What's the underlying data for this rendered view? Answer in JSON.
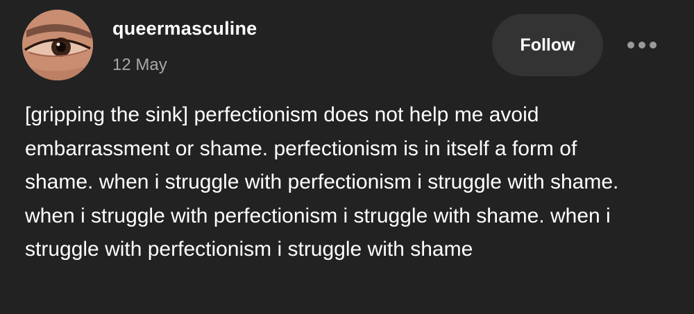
{
  "post": {
    "avatar_icon": "avatar-eye-closeup",
    "username": "queermasculine",
    "date": "12 May",
    "follow_label": "Follow",
    "more_icon": "more-horizontal-icon",
    "body": "[gripping the sink] perfectionism does not help me avoid embarrassment or shame. perfectionism is in itself a form of shame. when i struggle with perfectionism i struggle with shame. when i struggle with perfectionism i struggle with shame. when i struggle with perfectionism i struggle with shame"
  },
  "colors": {
    "background": "#222222",
    "text": "#ffffff",
    "muted": "#a8a8a8",
    "button_bg": "#333333"
  }
}
